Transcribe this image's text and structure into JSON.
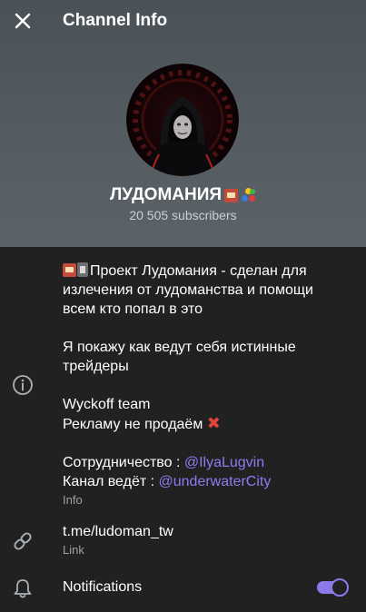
{
  "header": {
    "title": "Channel Info",
    "channel_name": "ЛУДОМАНИЯ",
    "subscribers": "20 505 subscribers"
  },
  "info": {
    "line1_text": "Проект Лудомания - сделан для",
    "line2": "излечения от лудоманства и помощи",
    "line3": "всем кто попал в это",
    "line4": "Я покажу как ведут себя истинные",
    "line5": "трейдеры",
    "line6": "Wyckoff team",
    "line7": "Рекламу не продаём",
    "coop_label": "Сотрудничество : ",
    "coop_mention": "@IlyaLugvin",
    "host_label": "Канал ведёт : ",
    "host_mention": "@underwaterCity",
    "sub_label": "Info"
  },
  "link": {
    "value": "t.me/ludoman_tw",
    "sub_label": "Link"
  },
  "notifications": {
    "label": "Notifications",
    "enabled": true
  },
  "colors": {
    "accent": "#8b7bea",
    "mention": "#8d7cf0",
    "background": "#212121",
    "header_bg": "#545c62"
  },
  "icons": [
    "close-icon",
    "info-icon",
    "link-icon",
    "bell-icon"
  ]
}
